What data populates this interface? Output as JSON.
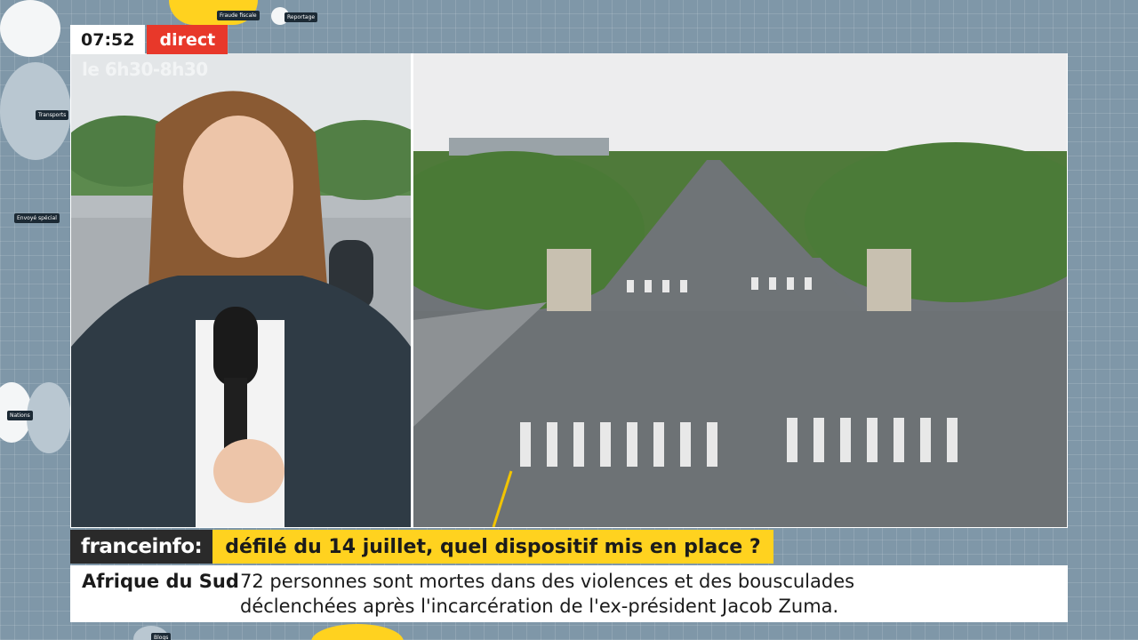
{
  "broadcast": {
    "time": "07:52",
    "live_label": "direct",
    "show_time": "le 6h30-8h30"
  },
  "brand": {
    "name": "franceinfo:",
    "headline": "défilé du 14 juillet, quel dispositif mis en place ?"
  },
  "ticker": {
    "topic": "Afrique du Sud",
    "line1": "72 personnes sont mortes dans des violences et des bousculades",
    "line2": "déclenchées après l'incarcération de l'ex-président Jacob Zuma."
  },
  "background_tags": [
    "Fraude fiscale",
    "Reportage",
    "Transports",
    "Envoyé spécial",
    "Nations",
    "Blogs"
  ],
  "colors": {
    "accent_yellow": "#ffd21f",
    "live_red": "#e8382a",
    "brand_dark": "#2a2a2a",
    "background": "#7f97a8"
  }
}
